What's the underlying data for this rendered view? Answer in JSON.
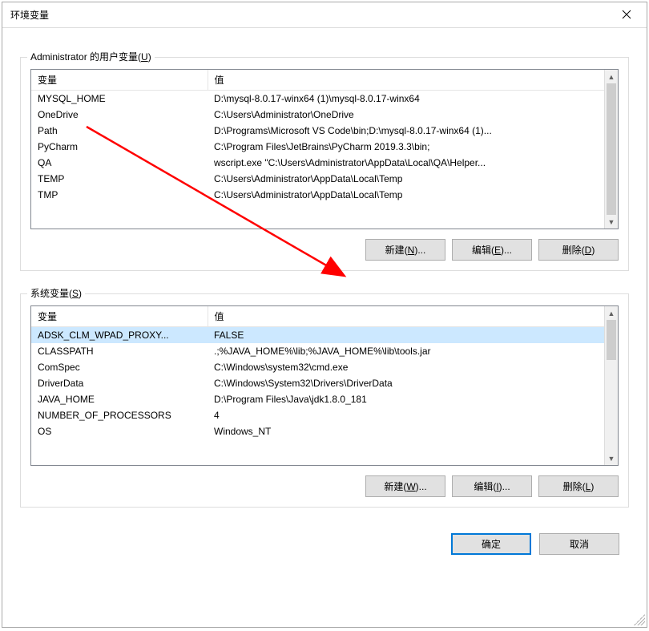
{
  "window": {
    "title": "环境变量"
  },
  "user_section": {
    "legend_prefix": "Administrator 的用户变量(",
    "legend_key": "U",
    "legend_suffix": ")",
    "headers": {
      "variable": "变量",
      "value": "值"
    },
    "rows": [
      {
        "name": "MYSQL_HOME",
        "value": "D:\\mysql-8.0.17-winx64 (1)\\mysql-8.0.17-winx64"
      },
      {
        "name": "OneDrive",
        "value": "C:\\Users\\Administrator\\OneDrive"
      },
      {
        "name": "Path",
        "value": "D:\\Programs\\Microsoft VS Code\\bin;D:\\mysql-8.0.17-winx64 (1)..."
      },
      {
        "name": "PyCharm",
        "value": "C:\\Program Files\\JetBrains\\PyCharm 2019.3.3\\bin;"
      },
      {
        "name": "QA",
        "value": "wscript.exe \"C:\\Users\\Administrator\\AppData\\Local\\QA\\Helper..."
      },
      {
        "name": "TEMP",
        "value": "C:\\Users\\Administrator\\AppData\\Local\\Temp"
      },
      {
        "name": "TMP",
        "value": "C:\\Users\\Administrator\\AppData\\Local\\Temp"
      }
    ],
    "buttons": {
      "new_prefix": "新建(",
      "new_key": "N",
      "new_suffix": ")...",
      "edit_prefix": "编辑(",
      "edit_key": "E",
      "edit_suffix": ")...",
      "delete_prefix": "删除(",
      "delete_key": "D",
      "delete_suffix": ")"
    }
  },
  "system_section": {
    "legend_prefix": "系统变量(",
    "legend_key": "S",
    "legend_suffix": ")",
    "headers": {
      "variable": "变量",
      "value": "值"
    },
    "rows": [
      {
        "name": "ADSK_CLM_WPAD_PROXY...",
        "value": "FALSE",
        "selected": true
      },
      {
        "name": "CLASSPATH",
        "value": ".;%JAVA_HOME%\\lib;%JAVA_HOME%\\lib\\tools.jar"
      },
      {
        "name": "ComSpec",
        "value": "C:\\Windows\\system32\\cmd.exe"
      },
      {
        "name": "DriverData",
        "value": "C:\\Windows\\System32\\Drivers\\DriverData"
      },
      {
        "name": "JAVA_HOME",
        "value": "D:\\Program Files\\Java\\jdk1.8.0_181"
      },
      {
        "name": "NUMBER_OF_PROCESSORS",
        "value": "4"
      },
      {
        "name": "OS",
        "value": "Windows_NT"
      }
    ],
    "buttons": {
      "new_prefix": "新建(",
      "new_key": "W",
      "new_suffix": ")...",
      "edit_prefix": "编辑(",
      "edit_key": "I",
      "edit_suffix": ")...",
      "delete_prefix": "删除(",
      "delete_key": "L",
      "delete_suffix": ")"
    }
  },
  "footer": {
    "ok": "确定",
    "cancel": "取消"
  }
}
